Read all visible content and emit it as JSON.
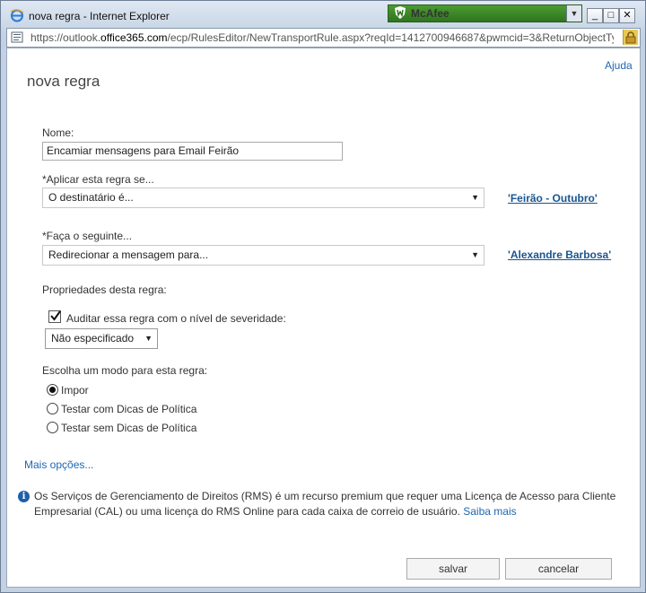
{
  "window": {
    "title": "nova regra - Internet Explorer",
    "mcafee_label": "McAfee",
    "url_prefix": "https://outlook.",
    "url_domain": "office365.com",
    "url_rest": "/ecp/RulesEditor/NewTransportRule.aspx?reqId=1412700946687&pwmcid=3&ReturnObjectTy"
  },
  "header": {
    "help_link": "Ajuda",
    "title": "nova regra"
  },
  "form": {
    "name_label": "Nome:",
    "name_value": "Encamiar mensagens para Email Feirão",
    "condition_label": "*Aplicar esta regra se...",
    "condition_value": "O destinatário é...",
    "condition_link": "'Feirão - Outubro'",
    "action_label": "*Faça o seguinte...",
    "action_value": "Redirecionar a mensagem para...",
    "action_link": "'Alexandre Barbosa'",
    "properties_label": "Propriedades desta regra:",
    "audit_label": "Auditar essa regra com o nível de severidade:",
    "audit_checked": true,
    "severity_value": "Não especificado",
    "mode_label": "Escolha um modo para esta regra:",
    "modes": [
      {
        "label": "Impor",
        "selected": true
      },
      {
        "label": "Testar com Dicas de Política",
        "selected": false
      },
      {
        "label": "Testar sem Dicas de Política",
        "selected": false
      }
    ],
    "more_options": "Mais opções..."
  },
  "info": {
    "text": "Os Serviços de Gerenciamento de Direitos (RMS) é um recurso premium que requer uma Licença de Acesso para Cliente Empresarial (CAL) ou uma licença do RMS Online para cada caixa de correio de usuário.",
    "link": "Saiba mais"
  },
  "buttons": {
    "save": "salvar",
    "cancel": "cancelar"
  },
  "icons": {
    "ie": "internet-explorer-icon",
    "mcafee": "mcafee-shield-icon",
    "lock": "lock-icon",
    "info": "info-icon"
  }
}
